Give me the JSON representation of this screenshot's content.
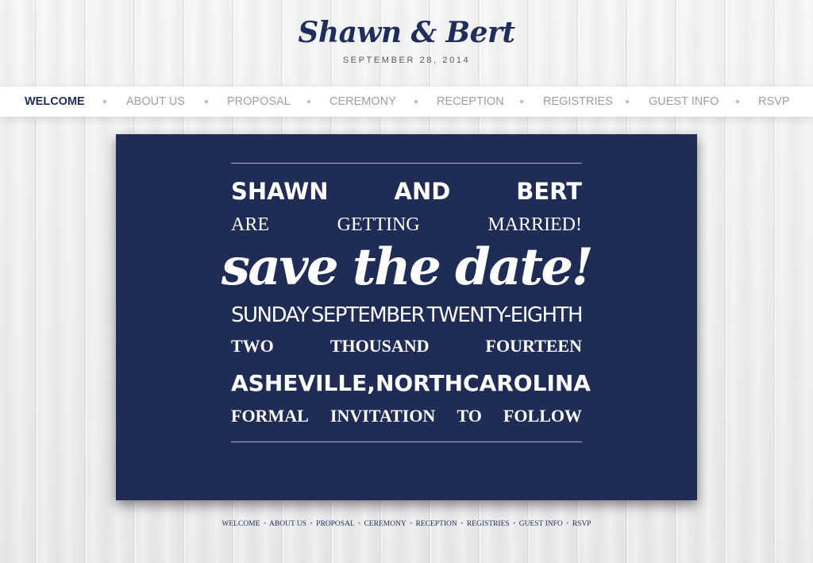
{
  "header": {
    "logo": "Shawn & Bert",
    "date": "SEPTEMBER 28, 2014"
  },
  "nav": {
    "items": [
      "WELCOME",
      "ABOUT US",
      "PROPOSAL",
      "CEREMONY",
      "RECEPTION",
      "REGISTRIES",
      "GUEST INFO",
      "RSVP"
    ],
    "active": "WELCOME"
  },
  "card": {
    "line1": [
      "SHAWN",
      "AND",
      "BERT"
    ],
    "line2": [
      "ARE",
      "GETTING",
      "MARRIED!"
    ],
    "line3": "save the date!",
    "line4": [
      "SUNDAY",
      "SEPTEMBER",
      "TWENTY-EIGHTH"
    ],
    "line5": [
      "TWO",
      "THOUSAND",
      "FOURTEEN"
    ],
    "line6": [
      "ASHEVILLE,",
      "NORTH",
      "CAROLINA"
    ],
    "line7": [
      "FORMAL",
      "INVITATION",
      "TO",
      "FOLLOW"
    ]
  },
  "footer": {
    "items": [
      "WELCOME",
      "ABOUT US",
      "PROPOSAL",
      "CEREMONY",
      "RECEPTION",
      "REGISTRIES",
      "GUEST INFO",
      "RSVP"
    ],
    "separator": "•"
  },
  "colors": {
    "navy": "#1e2c56",
    "nav_text": "#9a9ea6",
    "active_nav": "#1f2d5a"
  }
}
